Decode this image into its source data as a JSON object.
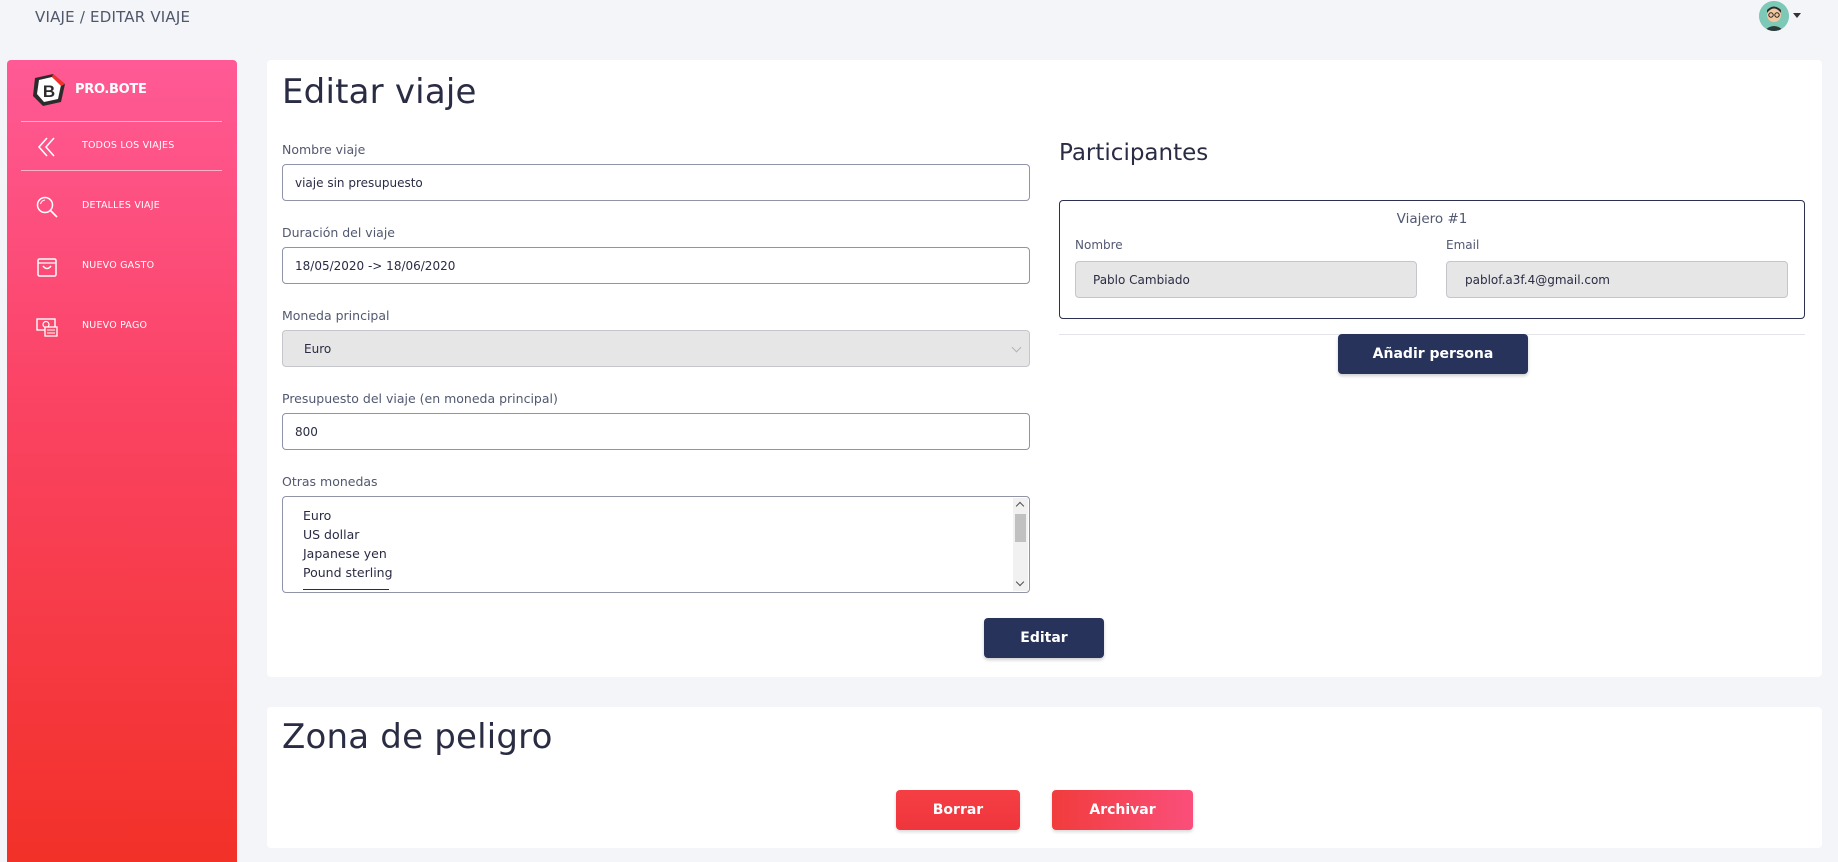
{
  "header": {
    "breadcrumb": "VIAJE / EDITAR VIAJE"
  },
  "sidebar": {
    "brand": "PRO.BOTE",
    "items": [
      {
        "label": "TODOS LOS VIAJES",
        "icon": "chevrons-left-icon"
      },
      {
        "label": "DETALLES VIAJE",
        "icon": "search-icon"
      },
      {
        "label": "NUEVO GASTO",
        "icon": "shopping-bag-icon"
      },
      {
        "label": "NUEVO PAGO",
        "icon": "money-icon"
      }
    ]
  },
  "edit": {
    "title": "Editar viaje",
    "name_label": "Nombre viaje",
    "name_value": "viaje sin presupuesto",
    "duration_label": "Duración del viaje",
    "duration_value": "18/05/2020 -> 18/06/2020",
    "currency_label": "Moneda principal",
    "currency_value": "Euro",
    "budget_label": "Presupuesto del viaje (en moneda principal)",
    "budget_value": "800",
    "other_currencies_label": "Otras monedas",
    "other_currencies": [
      "Euro",
      "US dollar",
      "Japanese yen",
      "Pound sterling"
    ],
    "submit_label": "Editar"
  },
  "participants": {
    "title": "Participantes",
    "traveler_title": "Viajero #1",
    "name_label": "Nombre",
    "name_value": "Pablo Cambiado",
    "email_label": "Email",
    "email_value": "pablof.a3f.4@gmail.com",
    "add_label": "Añadir persona"
  },
  "danger": {
    "title": "Zona de peligro",
    "delete_label": "Borrar",
    "archive_label": "Archivar"
  },
  "colors": {
    "sidebar_top": "#ff5a96",
    "sidebar_bottom": "#f23128",
    "primary_dark": "#27335a",
    "danger_red": "#f0353c"
  }
}
